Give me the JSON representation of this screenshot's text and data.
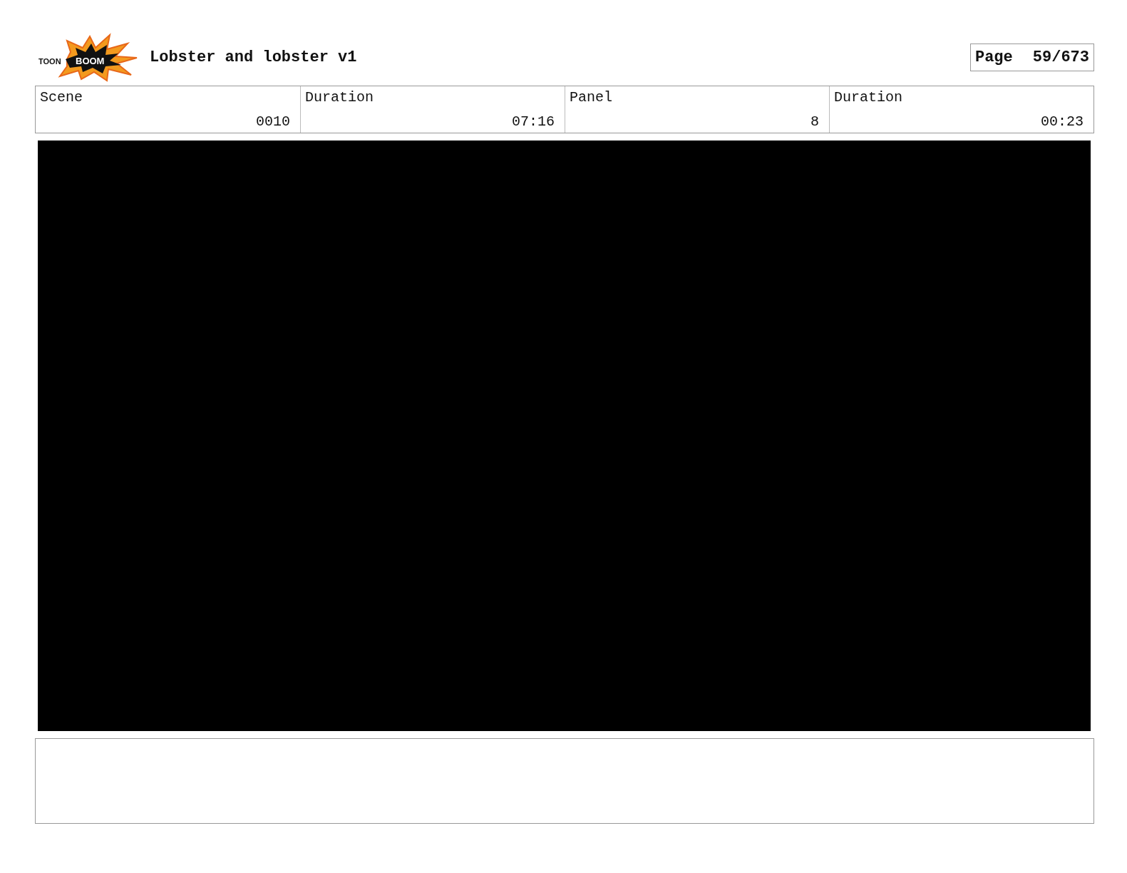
{
  "logo": {
    "word_1": "TOON",
    "word_2": "BOOM"
  },
  "title": "Lobster and lobster v1",
  "page": {
    "label": "Page",
    "value": "59/673"
  },
  "info": [
    {
      "label": "Scene",
      "value": "0010"
    },
    {
      "label": "Duration",
      "value": "07:16"
    },
    {
      "label": "Panel",
      "value": "8"
    },
    {
      "label": "Duration",
      "value": "00:23"
    }
  ]
}
